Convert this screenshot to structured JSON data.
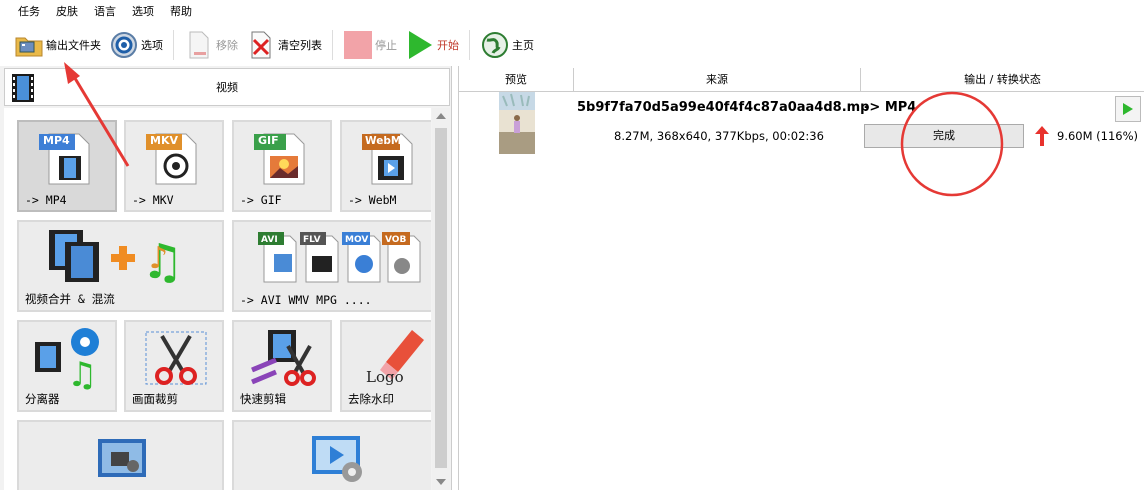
{
  "menu": [
    "任务",
    "皮肤",
    "语言",
    "选项",
    "帮助"
  ],
  "toolbar": {
    "output_folder": "输出文件夹",
    "options": "选项",
    "remove": "移除",
    "clear_list": "清空列表",
    "stop": "停止",
    "start": "开始",
    "home": "主页"
  },
  "left_panel": {
    "title": "视频",
    "tiles": {
      "mp4": {
        "badge": "MP4",
        "label": "-> MP4"
      },
      "mkv": {
        "badge": "MKV",
        "label": "-> MKV"
      },
      "gif": {
        "badge": "GIF",
        "label": "-> GIF"
      },
      "webm": {
        "badge": "WebM",
        "label": "-> WebM"
      },
      "merge": {
        "label": "视频合并 & 混流"
      },
      "others": {
        "badges": [
          "AVI",
          "FLV",
          "MOV",
          "VOB"
        ],
        "label": "-> AVI WMV MPG ...."
      },
      "splitter": {
        "label": "分离器"
      },
      "crop": {
        "label": "画面裁剪"
      },
      "quickcut": {
        "label": "快速剪辑"
      },
      "watermark": {
        "label": "去除水印",
        "logo_text": "Logo"
      }
    }
  },
  "right_panel": {
    "columns": {
      "preview": "预览",
      "source": "来源",
      "output": "输出 / 转换状态"
    },
    "task": {
      "file_name": "5b9f7fa70d5a99e40f4f4c87a0aa4d8.mp",
      "target": "-> MP4",
      "info": "8.27M, 368x640, 377Kbps, 00:02:36",
      "status": "完成",
      "output_size": "9.60M  (116%)"
    }
  },
  "colors": {
    "accent_green": "#2eb82e",
    "arrow_red": "#e8322d",
    "annotation_red": "#e53935"
  }
}
